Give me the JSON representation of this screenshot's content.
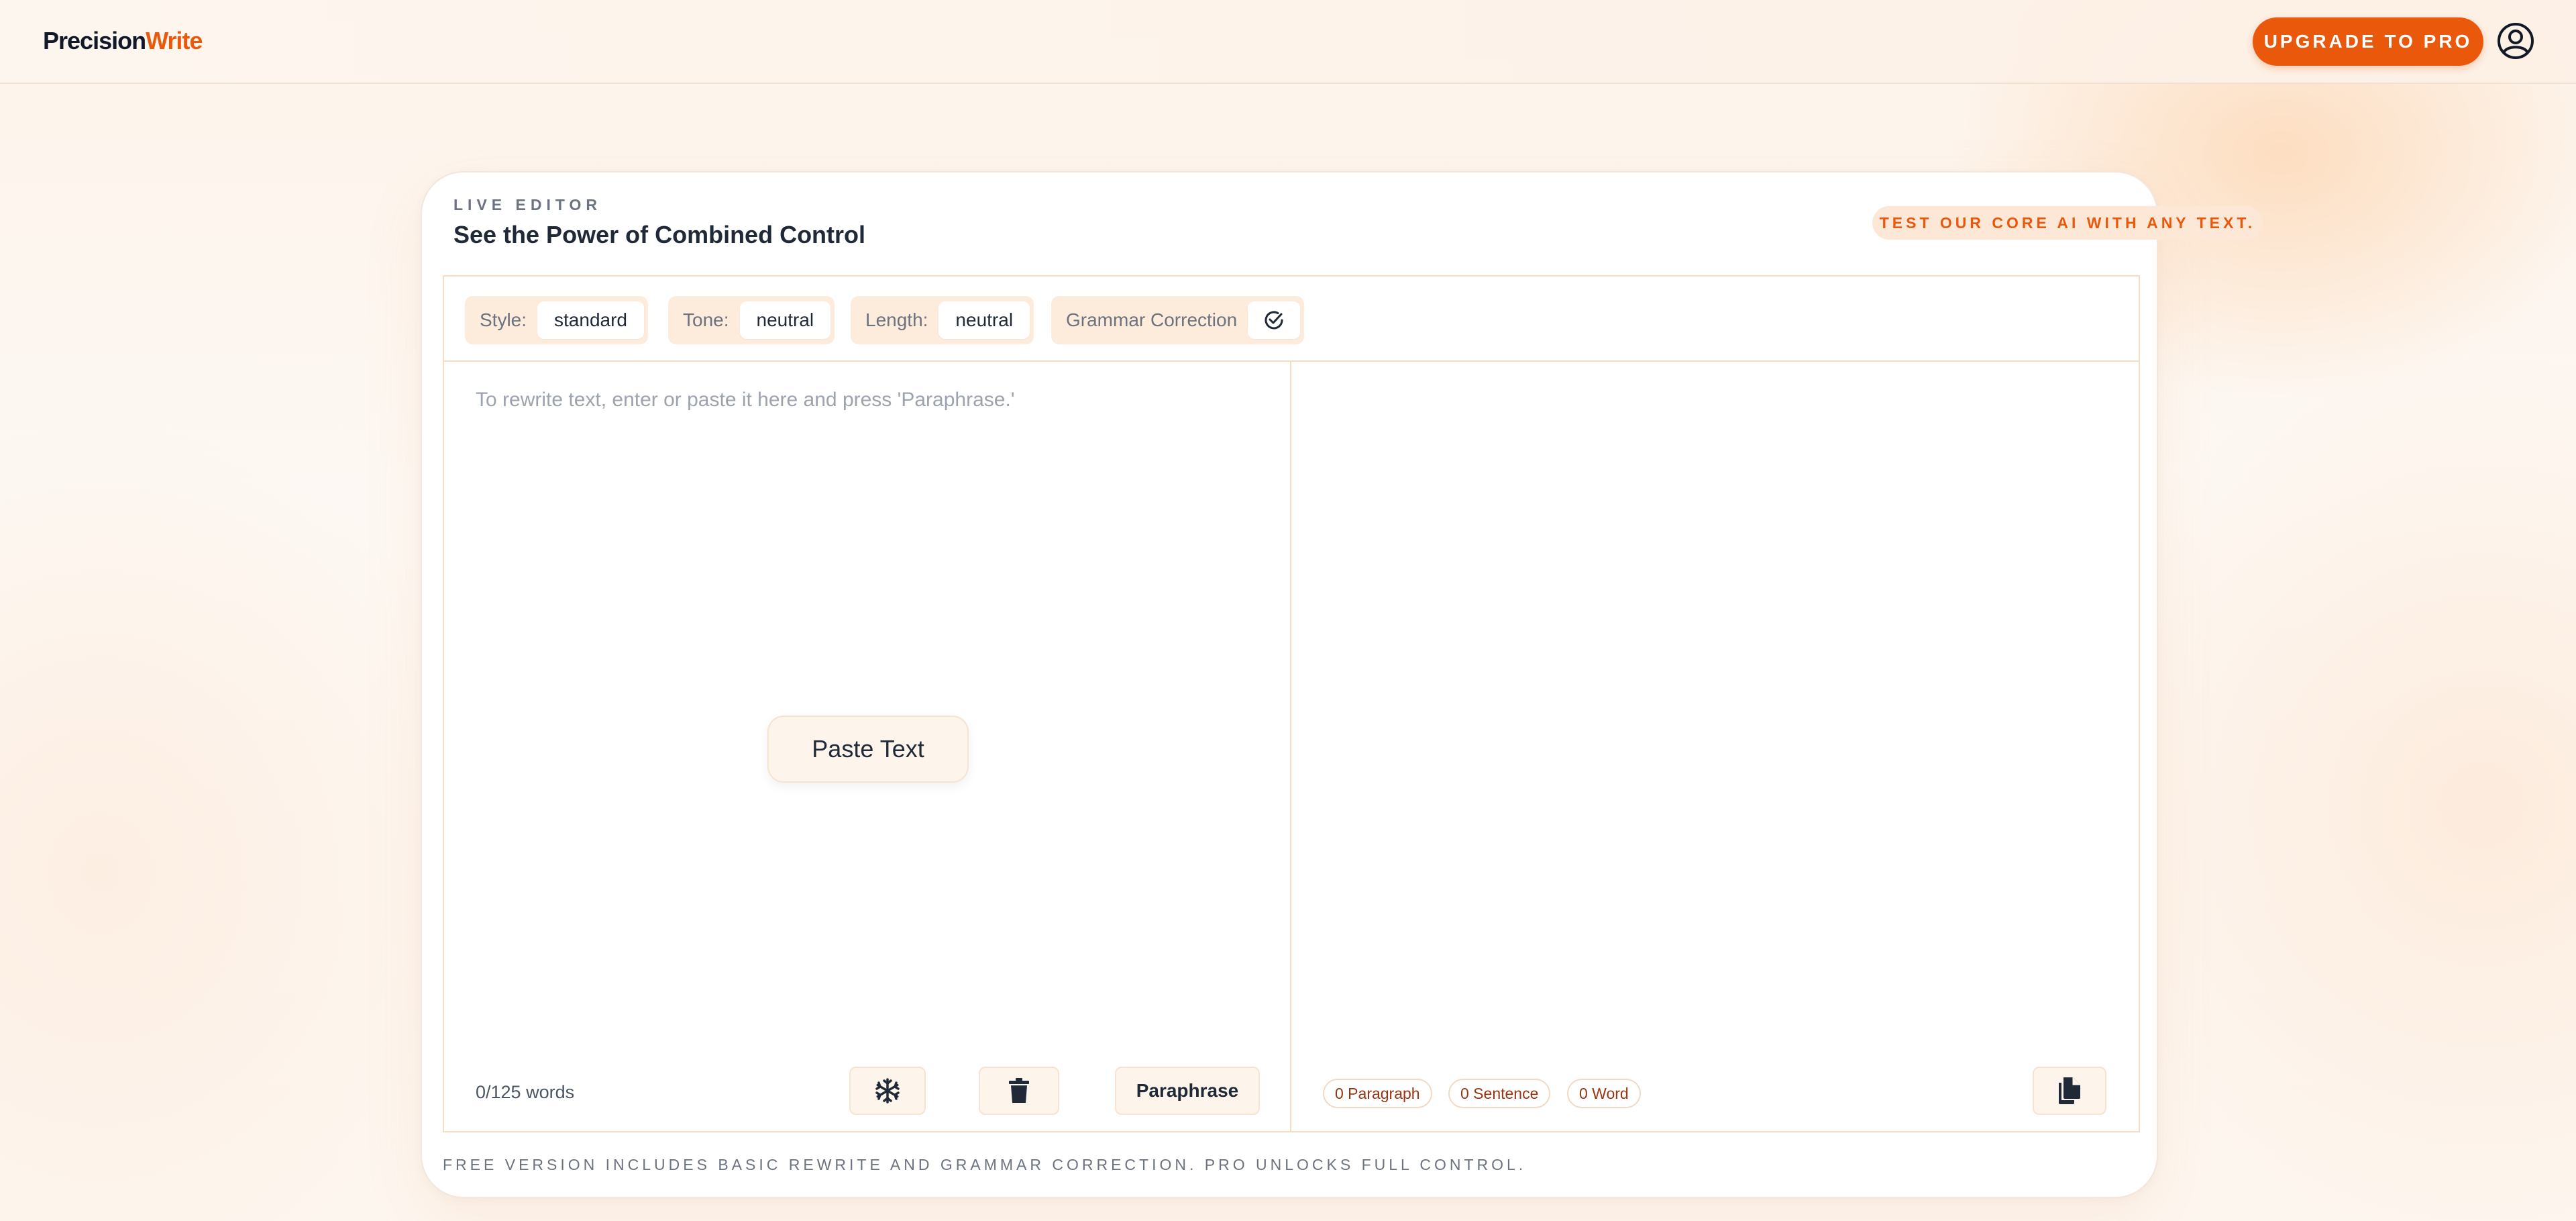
{
  "app": {
    "logo_part1": "Precision",
    "logo_part2": "Write"
  },
  "header": {
    "upgrade_label": "UPGRADE TO PRO",
    "profile_icon": "user-circle-icon"
  },
  "card": {
    "eyebrow": "LIVE EDITOR",
    "title": "See the Power of Combined Control",
    "badge": "TEST OUR CORE AI WITH ANY TEXT.",
    "footer_note": "FREE VERSION INCLUDES BASIC REWRITE AND GRAMMAR CORRECTION. PRO UNLOCKS FULL CONTROL."
  },
  "toolbar": {
    "style_label": "Style:",
    "style_value": "standard",
    "tone_label": "Tone:",
    "tone_value": "neutral",
    "length_label": "Length:",
    "length_value": "neutral",
    "grammar_label": "Grammar Correction",
    "grammar_icon": "check-circle-icon"
  },
  "input_pane": {
    "placeholder": "To rewrite text, enter or paste it here and press 'Paraphrase.'",
    "paste_label": "Paste Text",
    "word_count": "0/125 words",
    "freeze_icon": "snowflake-icon",
    "delete_icon": "trash-icon",
    "paraphrase_label": "Paraphrase"
  },
  "output_pane": {
    "paragraph_count": "0 Paragraph",
    "sentence_count": "0 Sentence",
    "word_count": "0 Word",
    "copy_icon": "copy-icon"
  },
  "colors": {
    "accent": "#ea580c",
    "background": "#fdf7f1",
    "chip_bg": "#fdebdb",
    "border": "#f6dcc4"
  }
}
